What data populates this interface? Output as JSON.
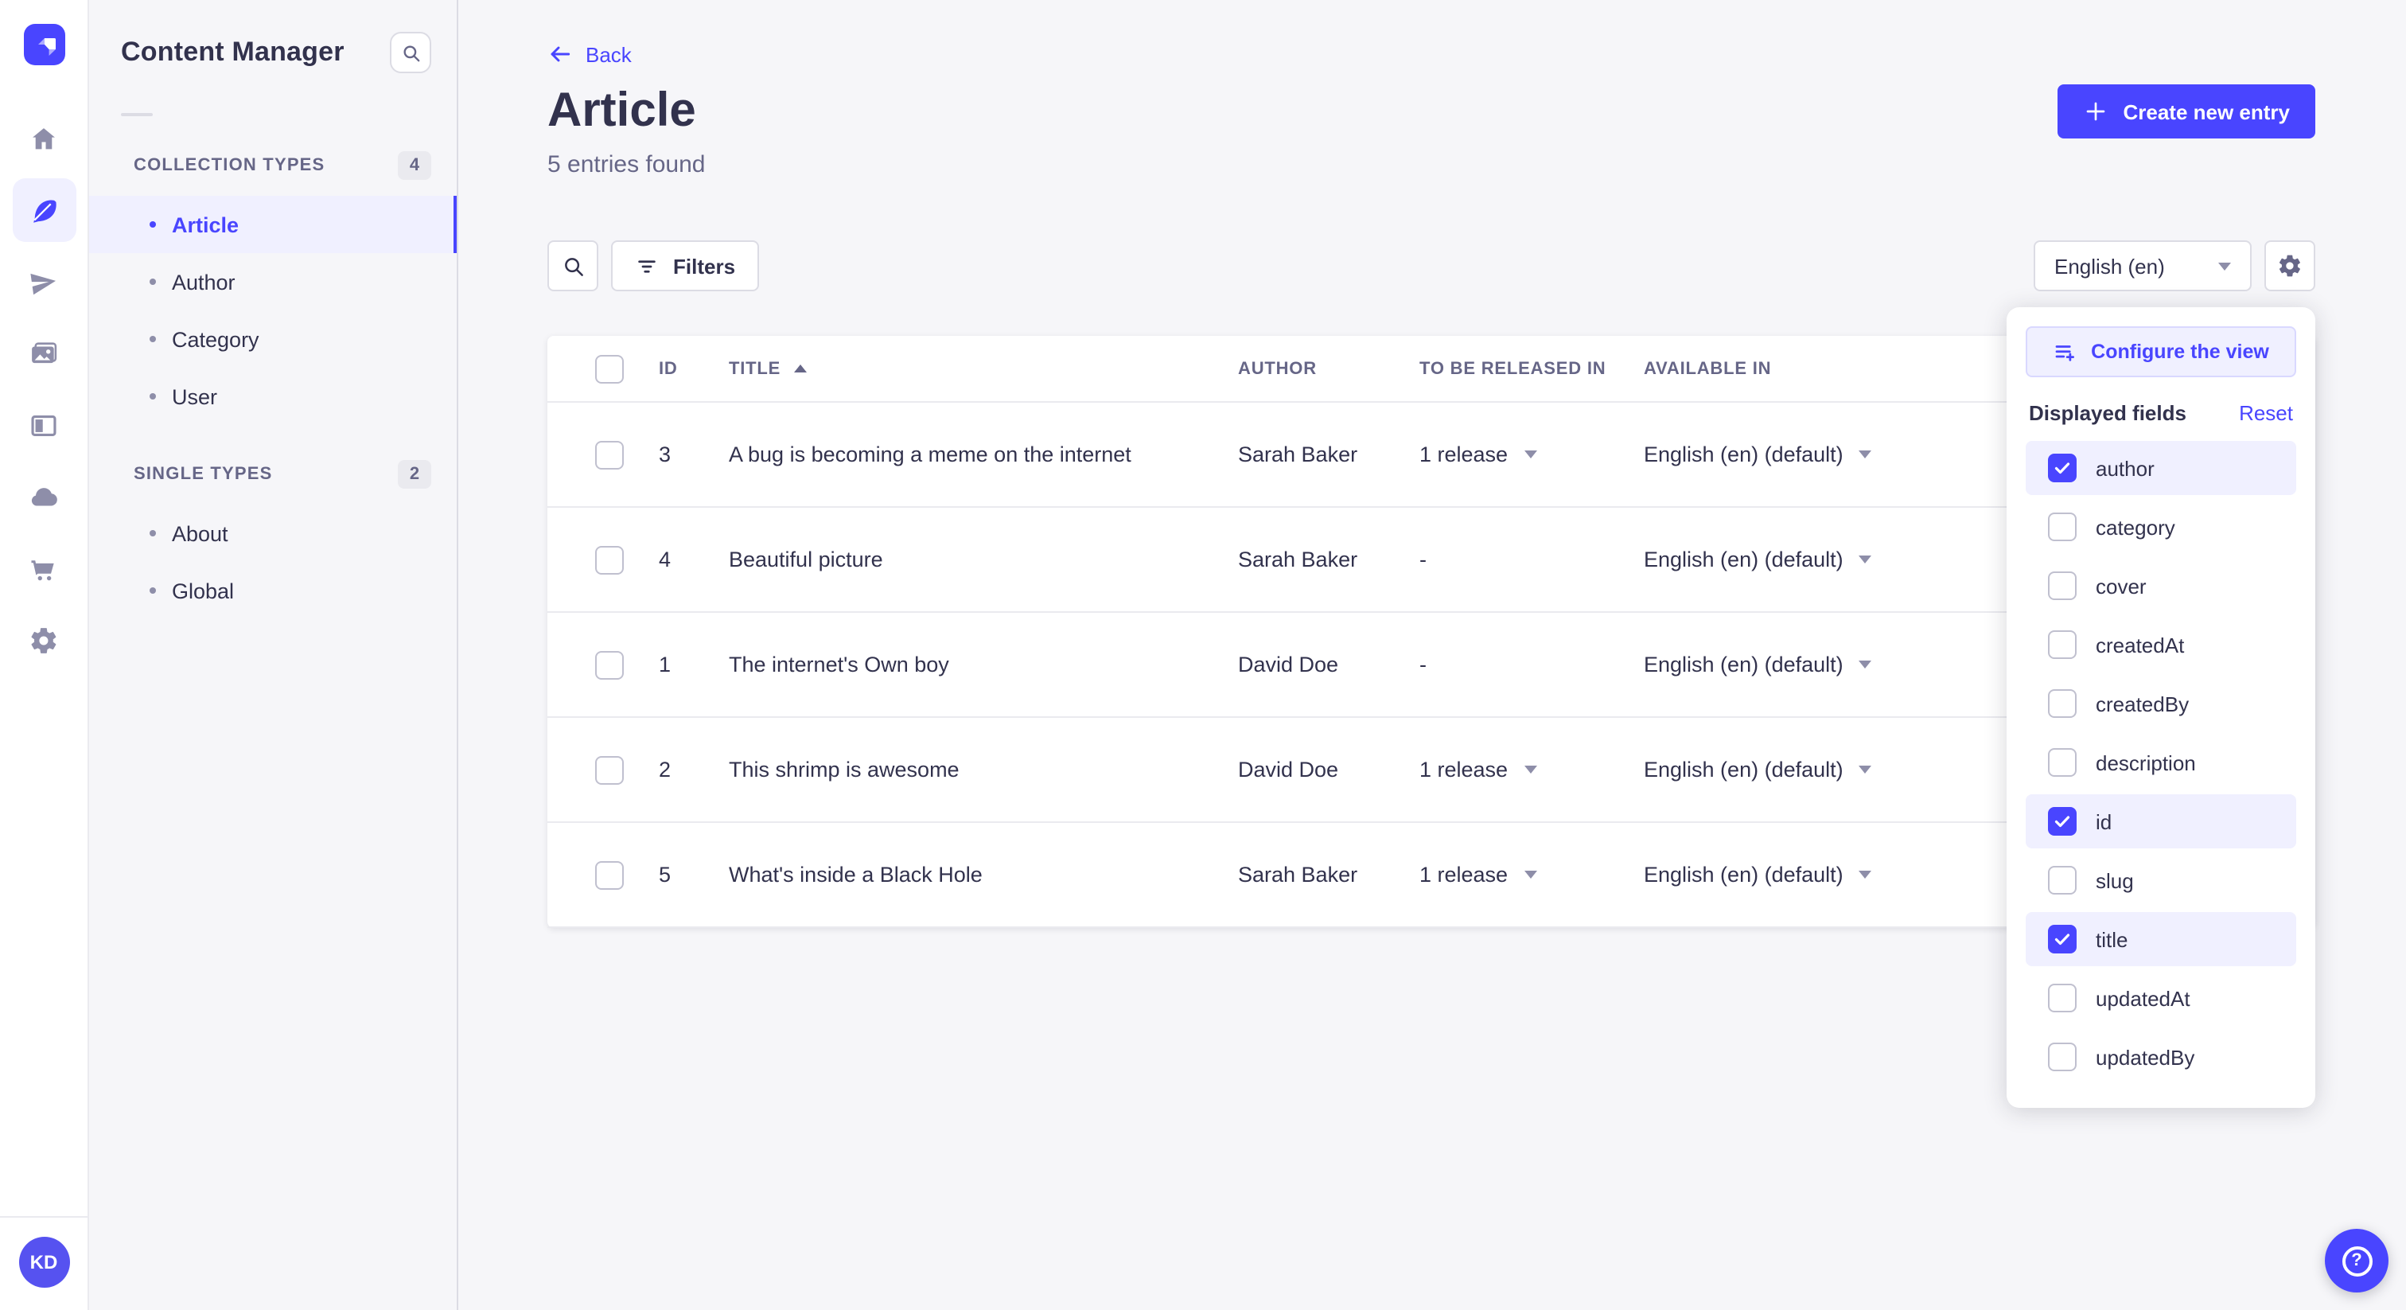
{
  "colors": {
    "accent": "#4945ff",
    "accent_light": "#f0f0ff",
    "accent_border": "#d9d8ff",
    "page_bg": "#f6f6f9",
    "text": "#32324d",
    "text_secondary": "#666687",
    "avatar_bg": "#5652f0"
  },
  "nav": {
    "rail_icons": [
      "home-icon",
      "feather-icon",
      "paper-plane-icon",
      "images-icon",
      "layout-icon",
      "cloud-icon",
      "cart-icon",
      "gear-icon"
    ],
    "active_icon": "feather-icon",
    "avatar_initials": "KD"
  },
  "subnav": {
    "title": "Content Manager",
    "sections": [
      {
        "label": "COLLECTION TYPES",
        "badge": "4",
        "items": [
          {
            "label": "Article",
            "active": true
          },
          {
            "label": "Author",
            "active": false
          },
          {
            "label": "Category",
            "active": false
          },
          {
            "label": "User",
            "active": false
          }
        ]
      },
      {
        "label": "SINGLE TYPES",
        "badge": "2",
        "items": [
          {
            "label": "About",
            "active": false
          },
          {
            "label": "Global",
            "active": false
          }
        ]
      }
    ]
  },
  "header": {
    "back_label": "Back",
    "title": "Article",
    "subtitle": "5 entries found",
    "create_label": "Create new entry"
  },
  "toolbar": {
    "filters_label": "Filters",
    "locale_value": "English (en)"
  },
  "table": {
    "columns": {
      "id": "ID",
      "title": "TITLE",
      "author": "AUTHOR",
      "released": "TO BE RELEASED IN",
      "available": "AVAILABLE IN"
    },
    "rows": [
      {
        "id": "3",
        "title": "A bug is becoming a meme on the internet",
        "author": "Sarah Baker",
        "released": "1 release",
        "released_caret": true,
        "available": "English (en) (default)"
      },
      {
        "id": "4",
        "title": "Beautiful picture",
        "author": "Sarah Baker",
        "released": "-",
        "released_caret": false,
        "available": "English (en) (default)"
      },
      {
        "id": "1",
        "title": "The internet's Own boy",
        "author": "David Doe",
        "released": "-",
        "released_caret": false,
        "available": "English (en) (default)"
      },
      {
        "id": "2",
        "title": "This shrimp is awesome",
        "author": "David Doe",
        "released": "1 release",
        "released_caret": true,
        "available": "English (en) (default)"
      },
      {
        "id": "5",
        "title": "What's inside a Black Hole",
        "author": "Sarah Baker",
        "released": "1 release",
        "released_caret": true,
        "available": "English (en) (default)"
      }
    ]
  },
  "popover": {
    "configure_label": "Configure the view",
    "fields_title": "Displayed fields",
    "reset_label": "Reset",
    "fields": [
      {
        "label": "author",
        "checked": true
      },
      {
        "label": "category",
        "checked": false
      },
      {
        "label": "cover",
        "checked": false
      },
      {
        "label": "createdAt",
        "checked": false
      },
      {
        "label": "createdBy",
        "checked": false
      },
      {
        "label": "description",
        "checked": false
      },
      {
        "label": "id",
        "checked": true
      },
      {
        "label": "slug",
        "checked": false
      },
      {
        "label": "title",
        "checked": true
      },
      {
        "label": "updatedAt",
        "checked": false
      },
      {
        "label": "updatedBy",
        "checked": false
      }
    ]
  }
}
